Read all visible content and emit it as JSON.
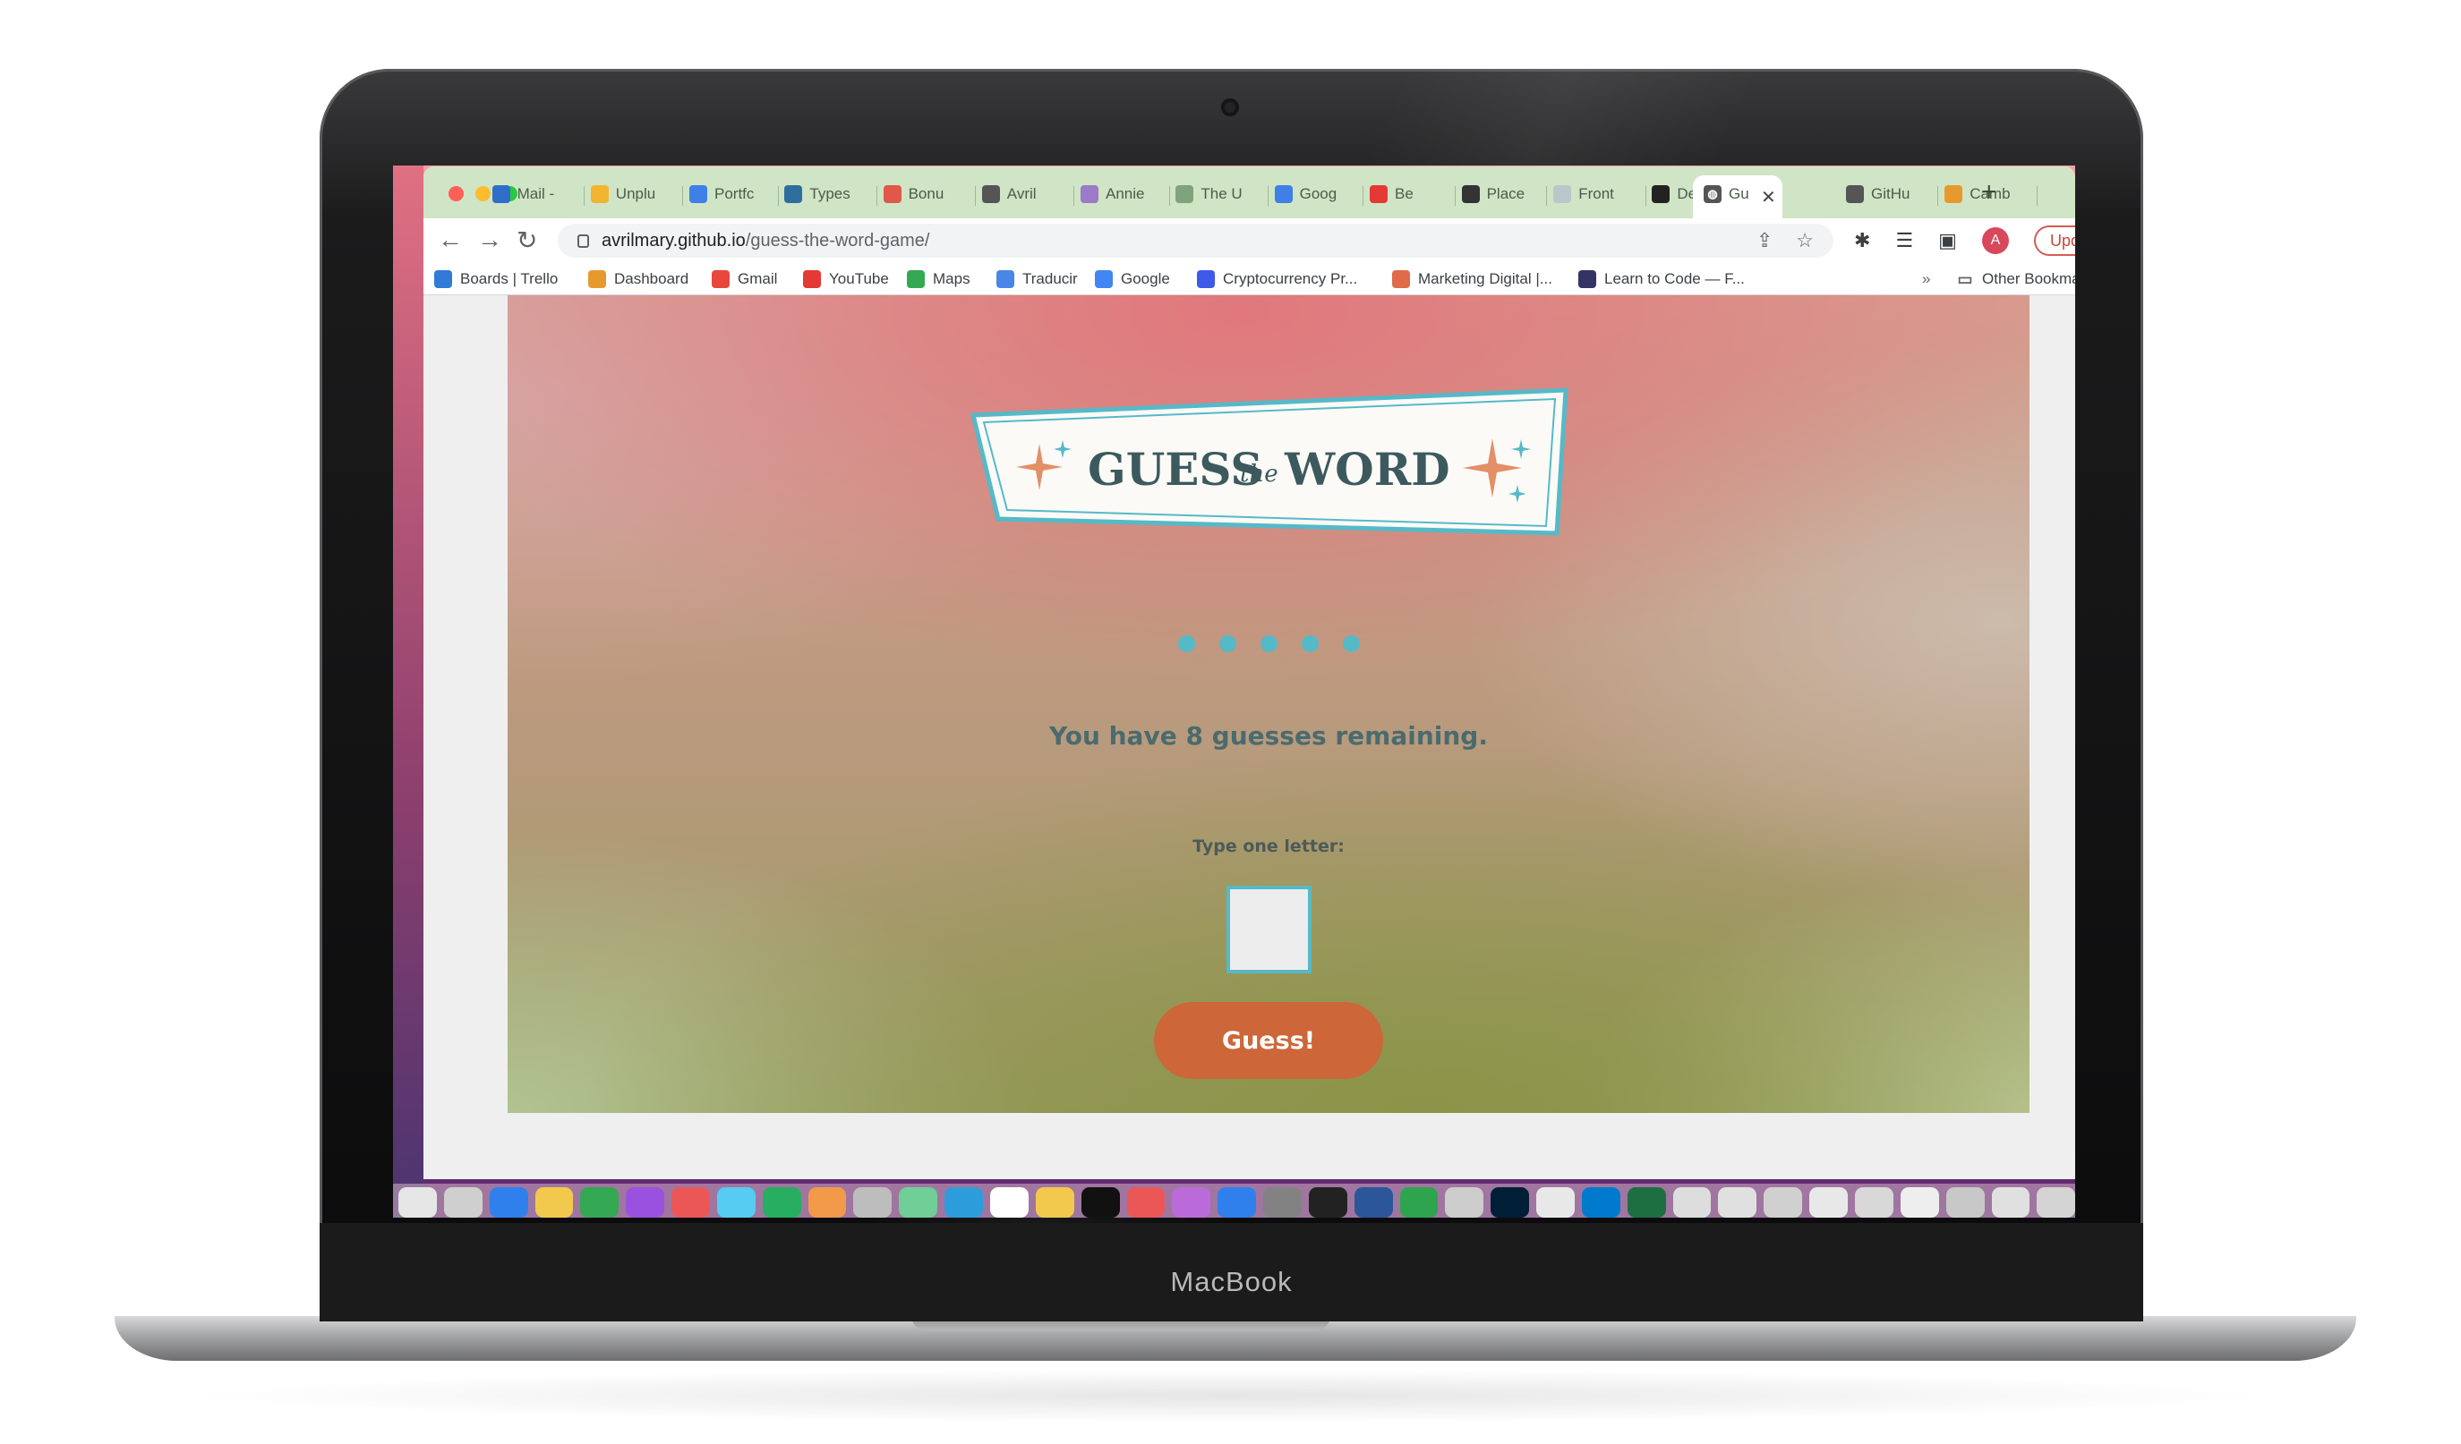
{
  "device": {
    "brand_label": "MacBook"
  },
  "browser": {
    "tabs": [
      {
        "label": "Mail -",
        "icon": "outlook-icon",
        "color": "#2f6fc9"
      },
      {
        "label": "Unplu",
        "icon": "drive-icon",
        "color": "#f2b52f"
      },
      {
        "label": "Portfc",
        "icon": "docs-icon",
        "color": "#3f7fe8"
      },
      {
        "label": "Types",
        "icon": "swirl-icon",
        "color": "#2e6e9e"
      },
      {
        "label": "Bonu",
        "icon": "bonus-icon",
        "color": "#e0584a"
      },
      {
        "label": "Avril",
        "icon": "globe-icon",
        "color": "#555555"
      },
      {
        "label": "Annie",
        "icon": "annie-icon",
        "color": "#9b7ac7"
      },
      {
        "label": "The U",
        "icon": "leaf-icon",
        "color": "#7fa37a"
      },
      {
        "label": "Goog",
        "icon": "calendar-icon",
        "color": "#3f7fe8"
      },
      {
        "label": "Be",
        "icon": "youtube-icon",
        "color": "#e53935"
      },
      {
        "label": "Place",
        "icon": "p-icon",
        "color": "#333333"
      },
      {
        "label": "Front",
        "icon": "circle-icon",
        "color": "#b8c7c9"
      },
      {
        "label": "Deplc",
        "icon": "github-icon",
        "color": "#222222"
      },
      {
        "label": "Gu",
        "icon": "globe-icon",
        "color": "#555555"
      },
      {
        "label": "GitHu",
        "icon": "globe-icon",
        "color": "#555555"
      },
      {
        "label": "Camb",
        "icon": "chrome-dash-icon",
        "color": "#e69a2e"
      }
    ],
    "address": {
      "host": "avrilmary.github.io",
      "path": "/guess-the-word-game/"
    },
    "avatar_letter": "A",
    "update_label": "Update",
    "bookmarks": [
      {
        "label": "Boards | Trello",
        "icon": "trello-icon",
        "color": "#2f7bd6"
      },
      {
        "label": "Dashboard",
        "icon": "dashboard-icon",
        "color": "#e69a2e"
      },
      {
        "label": "Gmail",
        "icon": "gmail-icon",
        "color": "#e8473b"
      },
      {
        "label": "YouTube",
        "icon": "youtube-icon",
        "color": "#e53935"
      },
      {
        "label": "Maps",
        "icon": "maps-icon",
        "color": "#34a853"
      },
      {
        "label": "Traducir",
        "icon": "translate-icon",
        "color": "#4a86e8"
      },
      {
        "label": "Google",
        "icon": "google-icon",
        "color": "#4285f4"
      },
      {
        "label": "Cryptocurrency Pr...",
        "icon": "crypto-icon",
        "color": "#3d5ae8"
      },
      {
        "label": "Marketing Digital |...",
        "icon": "marketing-icon",
        "color": "#e06a4a"
      },
      {
        "label": "Learn to Code — F...",
        "icon": "fcc-icon",
        "color": "#333366"
      }
    ],
    "more_bookmarks": "»",
    "other_bookmarks": "Other Bookma"
  },
  "game": {
    "title_main_1": "GUESS",
    "title_small": "the",
    "title_main_2": "WORD",
    "word_in_progress": "●●●●●",
    "remaining_text": "You have 8 guesses remaining.",
    "input_label": "Type one letter:",
    "input_value": "",
    "button_label": "Guess!",
    "accent_color": "#56b9c8",
    "button_color": "#cd6639"
  }
}
